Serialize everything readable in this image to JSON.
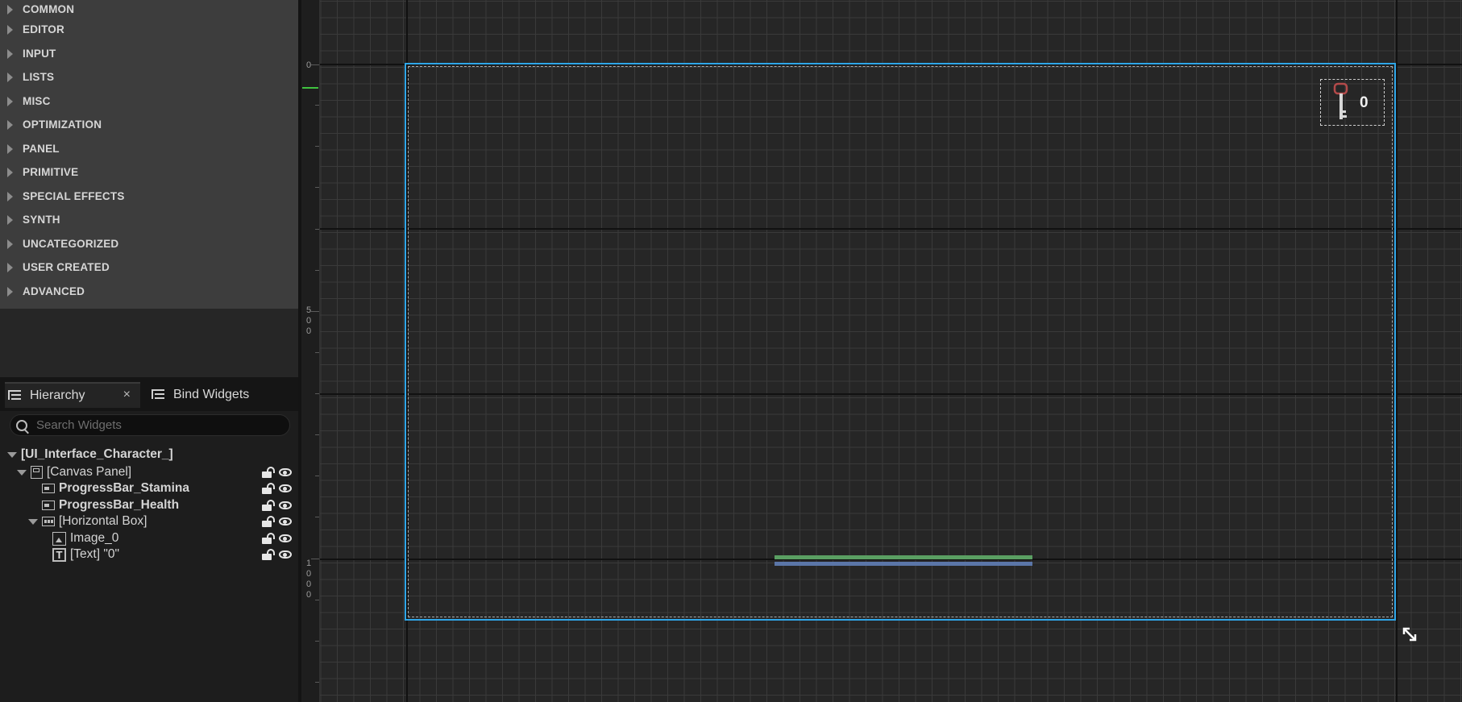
{
  "palette": {
    "categories": [
      "COMMON",
      "EDITOR",
      "INPUT",
      "LISTS",
      "MISC",
      "OPTIMIZATION",
      "PANEL",
      "PRIMITIVE",
      "SPECIAL EFFECTS",
      "SYNTH",
      "UNCATEGORIZED",
      "USER CREATED",
      "ADVANCED"
    ]
  },
  "tabs": {
    "hierarchy": "Hierarchy",
    "close": "×",
    "bind_widgets": "Bind Widgets"
  },
  "search": {
    "placeholder": "Search Widgets"
  },
  "hierarchy": {
    "root": "[UI_Interface_Character_]",
    "canvas_panel": "[Canvas Panel]",
    "progress_stamina": "ProgressBar_Stamina",
    "progress_health": "ProgressBar_Health",
    "horizontal_box": "[Horizontal Box]",
    "image": "Image_0",
    "text": "[Text] \"0\"",
    "text_icon": "T"
  },
  "ruler": {
    "zero": "0",
    "d500": [
      "5",
      "0",
      "0"
    ],
    "d1000": [
      "1",
      "0",
      "0",
      "0"
    ]
  },
  "canvas": {
    "key_count": "0",
    "frame_color": "#2fa6e8",
    "stamina_color": "#5a9f62",
    "health_color": "#5b76a8"
  },
  "icons": {
    "expand": "triangle-right-icon",
    "search": "search-icon",
    "lock": "lock-icon",
    "eye": "eye-icon",
    "key": "key-icon",
    "resize": "resize-icon"
  }
}
